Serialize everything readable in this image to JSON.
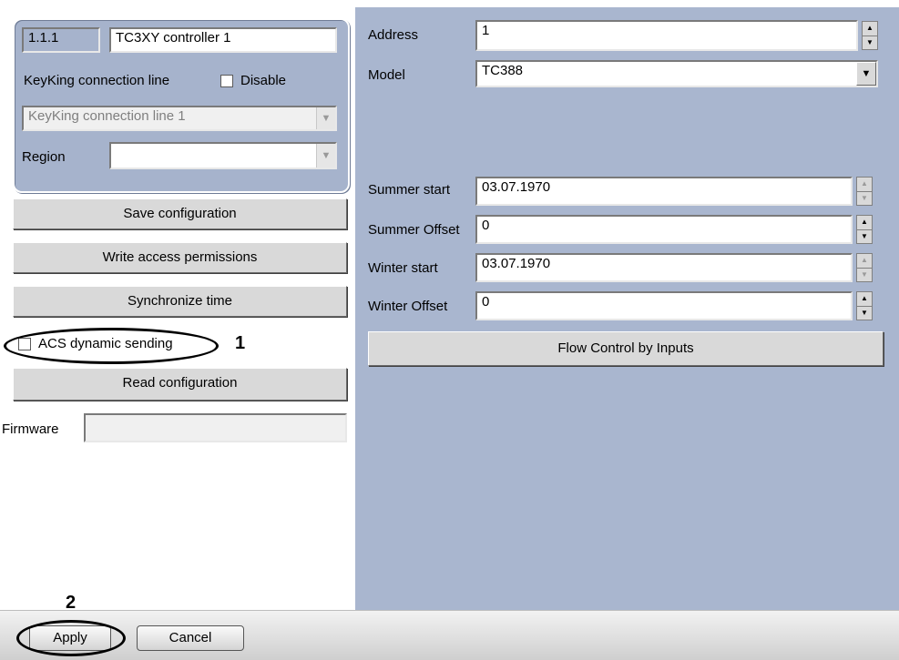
{
  "device": {
    "id": "1.1.1",
    "name": "TC3XY controller 1",
    "connection_label": "KeyKing connection line",
    "disable_label": "Disable",
    "connection_value": "KeyKing connection line 1",
    "region_label": "Region",
    "region_value": ""
  },
  "buttons": {
    "save": "Save configuration",
    "write": "Write access permissions",
    "sync": "Synchronize time",
    "read": "Read configuration",
    "flow": "Flow Control by Inputs",
    "apply": "Apply",
    "cancel": "Cancel"
  },
  "acs_label": "ACS dynamic sending",
  "firmware": {
    "label": "Firmware",
    "value": ""
  },
  "settings": {
    "address_label": "Address",
    "address_value": "1",
    "model_label": "Model",
    "model_value": "TC388",
    "summer_start_label": "Summer start",
    "summer_start_value": "03.07.1970",
    "summer_offset_label": "Summer Offset",
    "summer_offset_value": "0",
    "winter_start_label": "Winter start",
    "winter_start_value": "03.07.1970",
    "winter_offset_label": "Winter Offset",
    "winter_offset_value": "0"
  },
  "annotations": {
    "marker1": "1",
    "marker2": "2"
  },
  "colors": {
    "right_panel": "#a9b6cf",
    "group_box": "#a6b3cc",
    "button_face": "#d9d9d9"
  }
}
